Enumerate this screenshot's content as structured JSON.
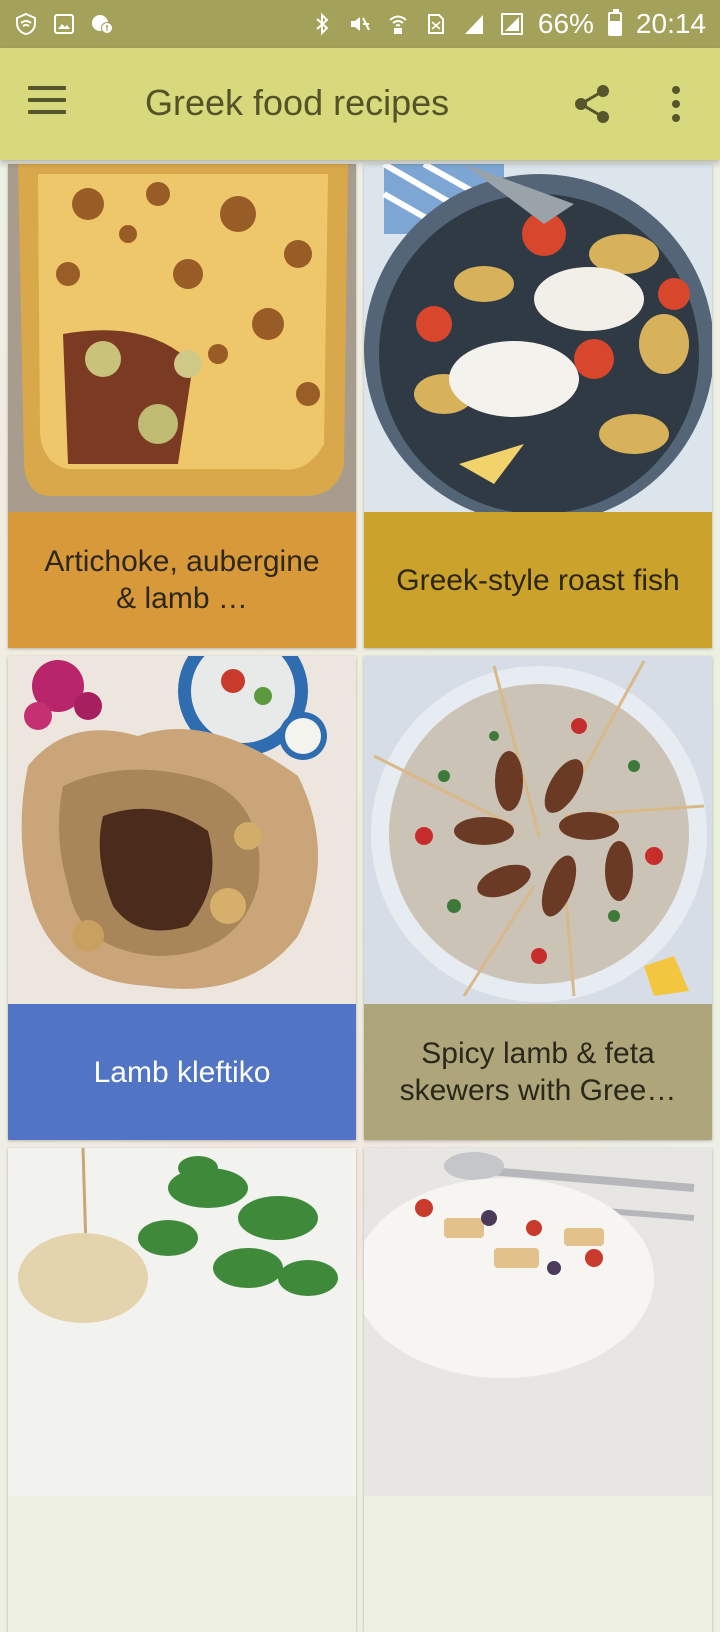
{
  "status_bar": {
    "battery_percent": "66%",
    "battery_level": 0.66,
    "time": "20:14",
    "icons": [
      "shield-wifi-icon",
      "gallery-icon",
      "chat-alert-icon",
      "bluetooth-icon",
      "mute-icon",
      "wifi-call-icon",
      "sim-icon",
      "signal-icon",
      "signal-box-icon",
      "battery-icon"
    ]
  },
  "toolbar": {
    "title": "Greek food recipes",
    "menu_icon": "hamburger-menu-icon",
    "share_icon": "share-icon",
    "overflow_icon": "more-vert-icon",
    "background": "#d8d97c"
  },
  "recipes": [
    {
      "title": "Artichoke, aubergine & lamb …",
      "caption_color": "#d7993a"
    },
    {
      "title": "Greek-style roast fish",
      "caption_color": "#cba22b"
    },
    {
      "title": "Lamb kleftiko",
      "caption_color": "#5274c4"
    },
    {
      "title": "Spicy lamb & feta skewers with Gree…",
      "caption_color": "#aea67a"
    },
    {
      "title": "",
      "caption_color": ""
    },
    {
      "title": "",
      "caption_color": ""
    }
  ]
}
